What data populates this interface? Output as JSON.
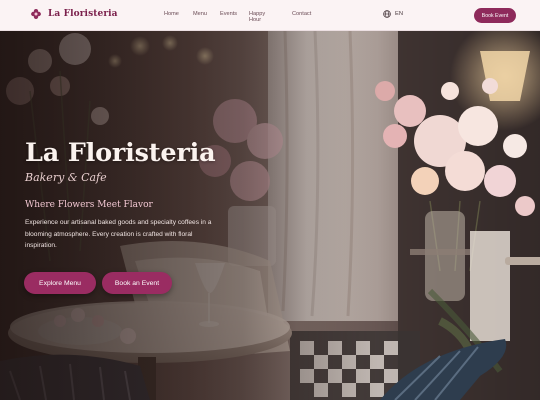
{
  "header": {
    "brand": "La Floristeria",
    "nav": [
      "Home",
      "Menu",
      "Events",
      "Happy Hour",
      "Contact"
    ],
    "language": "EN",
    "book_button": "Book Event"
  },
  "hero": {
    "title": "La Floristeria",
    "subtitle": "Bakery & Cafe",
    "tagline": "Where Flowers Meet Flavor",
    "description": "Experience our artisanal baked goods and specialty coffees in a blooming atmosphere. Every creation is crafted with floral inspiration.",
    "primary_button": "Explore Menu",
    "secondary_button": "Book an Event"
  },
  "colors": {
    "brand": "#7a1f4b",
    "accent": "#9a2c62",
    "header_bg": "#fbf3f4"
  },
  "icons": {
    "logo": "flower-logo-icon",
    "language": "globe-icon"
  }
}
